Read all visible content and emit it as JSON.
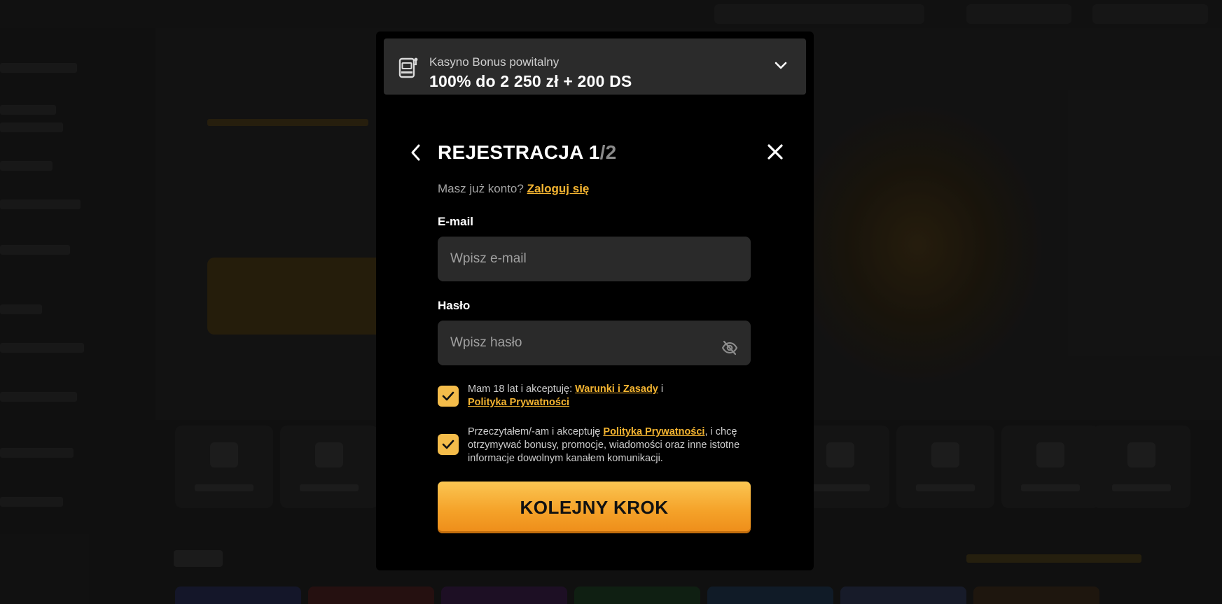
{
  "bonus": {
    "subtitle": "Kasyno Bonus powitalny",
    "title": "100% do 2 250 zł + 200 DS",
    "icon": "slot-machine-icon"
  },
  "header": {
    "title_main": "REJESTRACJA 1",
    "title_total": "/2",
    "back_icon": "chevron-left-icon",
    "close_icon": "close-icon"
  },
  "login": {
    "prompt": "Masz już konto?",
    "link": "Zaloguj się"
  },
  "form": {
    "email_label": "E-mail",
    "email_placeholder": "Wpisz e-mail",
    "email_value": "",
    "password_label": "Hasło",
    "password_placeholder": "Wpisz hasło",
    "password_value": ""
  },
  "consents": {
    "terms_text_1": "Mam 18 lat i akceptuję: ",
    "terms_link_1": "Warunki i Zasady",
    "terms_text_2": " i",
    "terms_link_2": "Polityka Prywatności",
    "terms_checked": true,
    "marketing_text_1": "Przeczytałem/-am i akceptuję ",
    "marketing_link": "Polityka Prywatności",
    "marketing_text_2": ", i chcę otrzymywać bonusy, promocje, wiadomości oraz inne istotne informacje dowolnym kanałem komunikacji.",
    "marketing_checked": true
  },
  "actions": {
    "next_label": "KOLEJNY KROK"
  },
  "colors": {
    "accent": "#f5b531",
    "checkbox": "#f4bc4a",
    "modal_bg": "#000000",
    "input_bg": "#2a2a2a"
  }
}
